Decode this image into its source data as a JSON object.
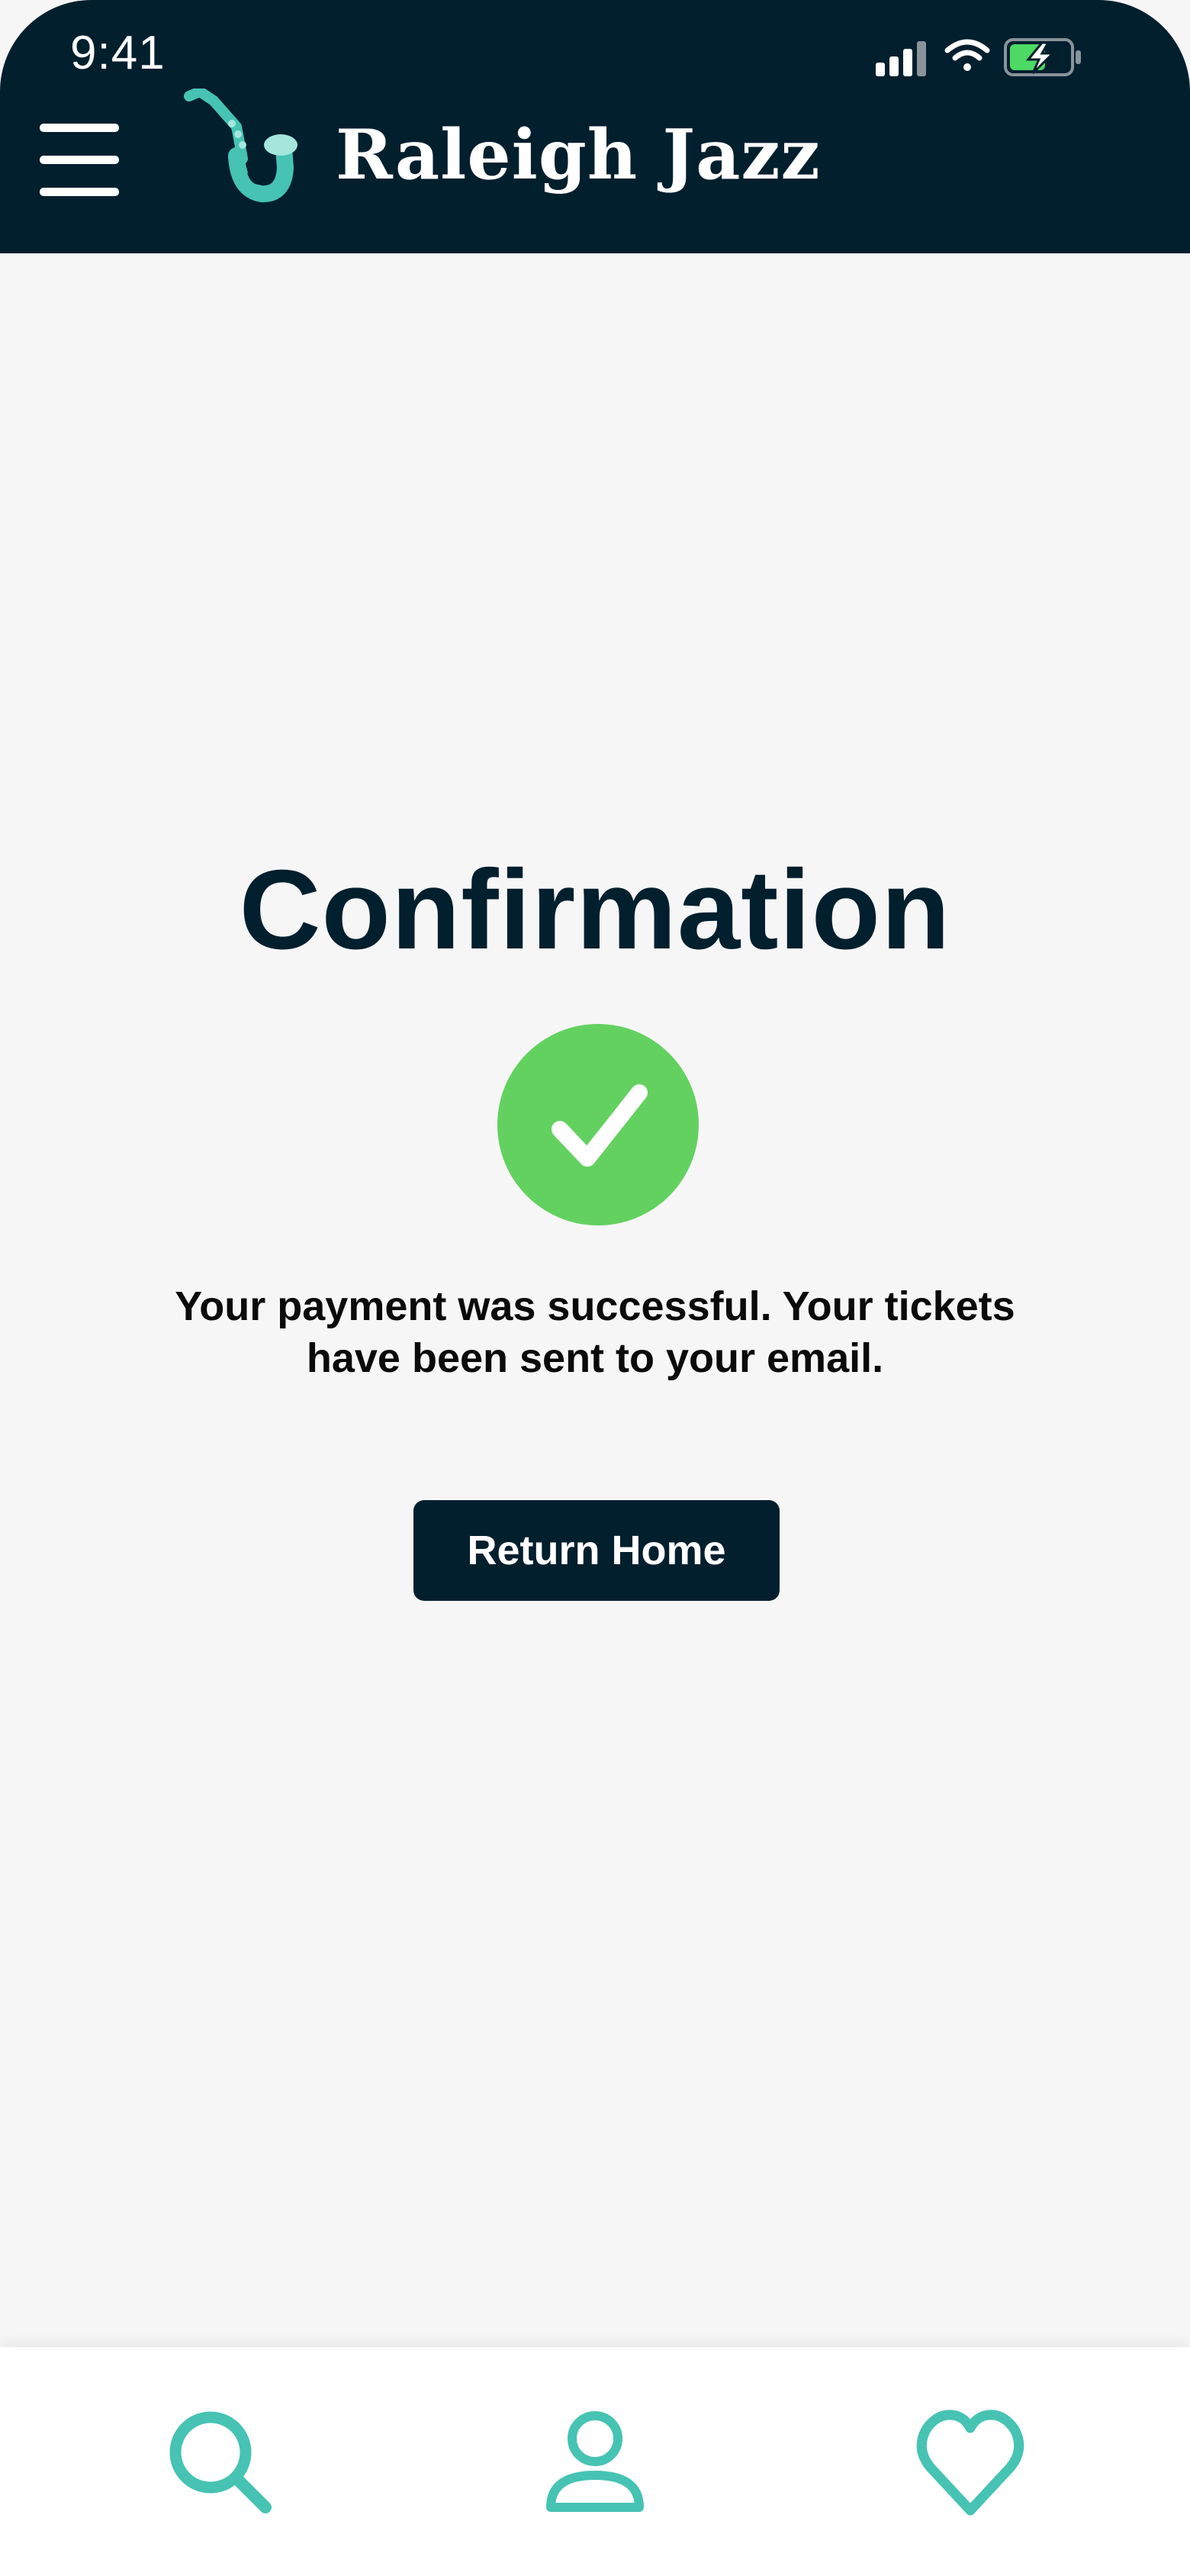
{
  "status_bar": {
    "time": "9:41",
    "battery_color": "#4cd964"
  },
  "header": {
    "menu_icon": "hamburger-menu-icon",
    "logo_icon": "saxophone-icon",
    "brand": "Raleigh Jazz",
    "background_color": "#021f2e",
    "accent_color": "#46c3b3"
  },
  "main": {
    "title": "Confirmation",
    "success_icon": "checkmark-circle-icon",
    "success_color": "#63d160",
    "message": "Your payment was successful. Your tickets have been sent to your email.",
    "return_home_label": "Return Home"
  },
  "tab_bar": {
    "items": [
      {
        "icon": "search-icon"
      },
      {
        "icon": "user-icon"
      },
      {
        "icon": "heart-icon"
      }
    ],
    "icon_color": "#46c3b3"
  }
}
